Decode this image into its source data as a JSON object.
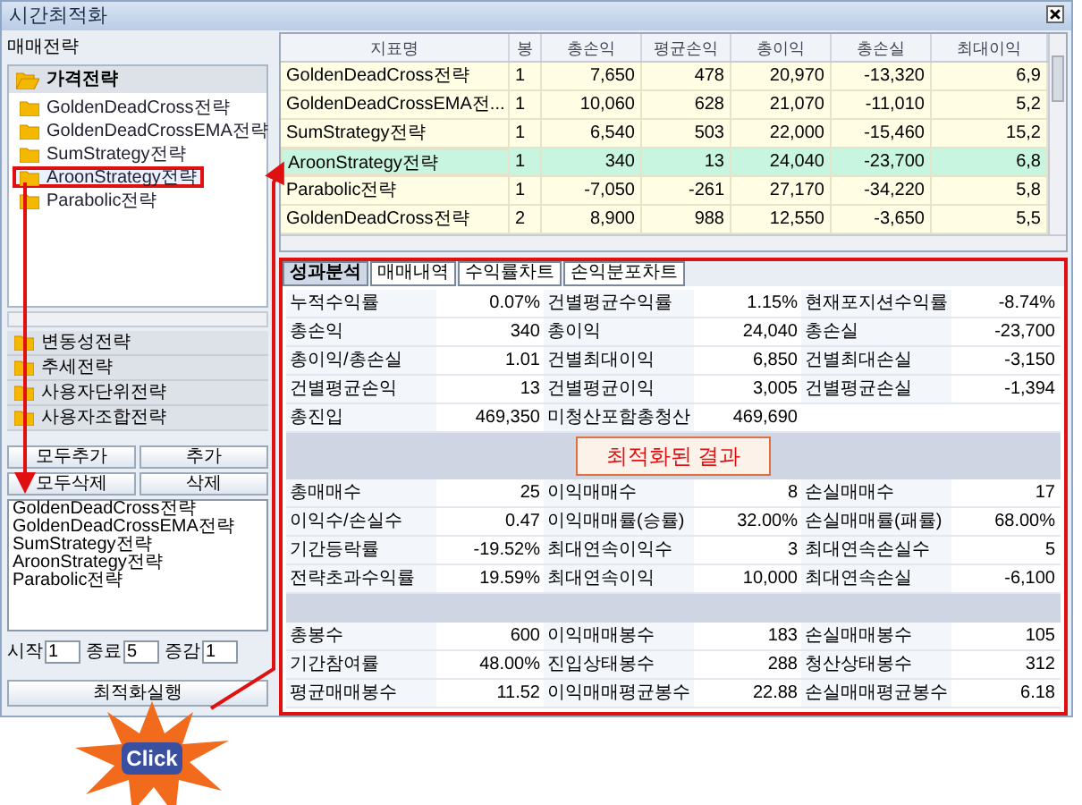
{
  "window": {
    "title": "시간최적화"
  },
  "sidebar": {
    "header": "매매전략",
    "groups": [
      {
        "label": "가격전략",
        "expanded": true,
        "children": [
          {
            "label": "GoldenDeadCross전략",
            "selected": false
          },
          {
            "label": "GoldenDeadCrossEMA전략",
            "selected": false
          },
          {
            "label": "SumStrategy전략",
            "selected": false
          },
          {
            "label": "AroonStrategy전략",
            "selected": true
          },
          {
            "label": "Parabolic전략",
            "selected": false
          }
        ]
      },
      {
        "label": "변동성전략",
        "expanded": false
      },
      {
        "label": "추세전략",
        "expanded": false
      },
      {
        "label": "사용자단위전략",
        "expanded": false
      },
      {
        "label": "사용자조합전략",
        "expanded": false
      }
    ],
    "buttons": [
      "모두추가",
      "추가",
      "모두삭제",
      "삭제"
    ],
    "list": [
      "GoldenDeadCross전략",
      "GoldenDeadCrossEMA전략",
      "SumStrategy전략",
      "AroonStrategy전략",
      "Parabolic전략"
    ],
    "range": [
      {
        "label": "시작",
        "value": "1"
      },
      {
        "label": "종료",
        "value": "5"
      },
      {
        "label": "증감",
        "value": "1"
      }
    ],
    "run_button": "최적화실행"
  },
  "table": {
    "columns": [
      "지표명",
      "봉",
      "총손익",
      "평균손익",
      "총이익",
      "총손실",
      "최대이익"
    ],
    "rows": [
      {
        "cells": [
          "GoldenDeadCross전략",
          "1",
          "7,650",
          "478",
          "20,970",
          "-13,320",
          "6,9"
        ],
        "selected": false
      },
      {
        "cells": [
          "GoldenDeadCrossEMA전...",
          "1",
          "10,060",
          "628",
          "21,070",
          "-11,010",
          "5,2"
        ],
        "selected": false
      },
      {
        "cells": [
          "SumStrategy전략",
          "1",
          "6,540",
          "503",
          "22,000",
          "-15,460",
          "15,2"
        ],
        "selected": false
      },
      {
        "cells": [
          "AroonStrategy전략",
          "1",
          "340",
          "13",
          "24,040",
          "-23,700",
          "6,8"
        ],
        "selected": true
      },
      {
        "cells": [
          "Parabolic전략",
          "1",
          "-7,050",
          "-261",
          "27,170",
          "-34,220",
          "5,8"
        ],
        "selected": false
      },
      {
        "cells": [
          "GoldenDeadCross전략",
          "2",
          "8,900",
          "988",
          "12,550",
          "-3,650",
          "5,5"
        ],
        "selected": false
      }
    ]
  },
  "tabs": [
    {
      "label": "성과분석",
      "selected": true
    },
    {
      "label": "매매내역",
      "selected": false
    },
    {
      "label": "수익률차트",
      "selected": false
    },
    {
      "label": "손익분포차트",
      "selected": false
    }
  ],
  "stats": [
    [
      [
        "누적수익률",
        "0.07%",
        "건별평균수익률",
        "1.15%",
        "현재포지션수익률",
        "-8.74%"
      ],
      [
        "총손익",
        "340",
        "총이익",
        "24,040",
        "총손실",
        "-23,700"
      ],
      [
        "총이익/총손실",
        "1.01",
        "건별최대이익",
        "6,850",
        "건별최대손실",
        "-3,150"
      ],
      [
        "건별평균손익",
        "13",
        "건별평균이익",
        "3,005",
        "건별평균손실",
        "-1,394"
      ],
      [
        "총진입",
        "469,350",
        "미청산포함총청산",
        "469,690"
      ]
    ],
    [
      [
        "총매매수",
        "25",
        "이익매매수",
        "8",
        "손실매매수",
        "17"
      ],
      [
        "이익수/손실수",
        "0.47",
        "이익매매률(승률)",
        "32.00%",
        "손실매매률(패률)",
        "68.00%"
      ],
      [
        "기간등락률",
        "-19.52%",
        "최대연속이익수",
        "3",
        "최대연속손실수",
        "5"
      ],
      [
        "전략초과수익률",
        "19.59%",
        "최대연속이익",
        "10,000",
        "최대연속손실",
        "-6,100"
      ]
    ],
    [
      [
        "총봉수",
        "600",
        "이익매매봉수",
        "183",
        "손실매매봉수",
        "105"
      ],
      [
        "기간참여률",
        "48.00%",
        "진입상태봉수",
        "288",
        "청산상태봉수",
        "312"
      ],
      [
        "평균매매봉수",
        "11.52",
        "이익매매평균봉수",
        "22.88",
        "손실매매평균봉수",
        "6.18"
      ]
    ]
  ],
  "callout": "최적화된 결과",
  "click_label": "Click"
}
